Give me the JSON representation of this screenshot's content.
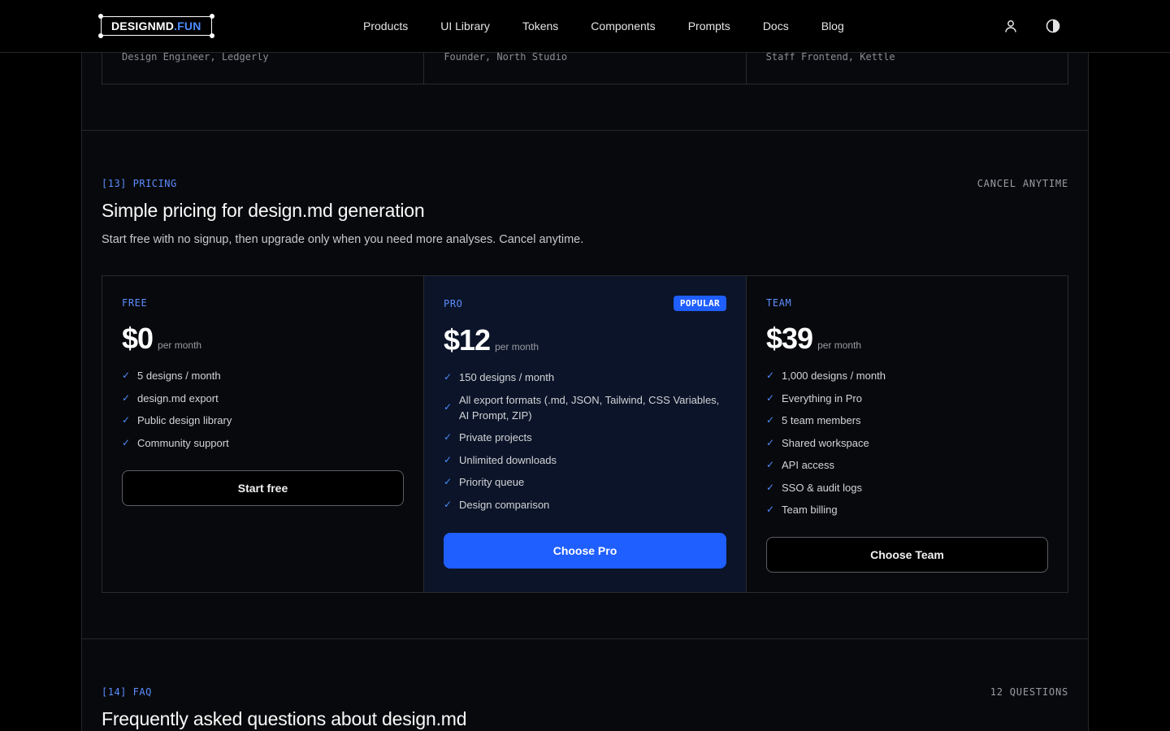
{
  "brand": {
    "name": "DESIGNMD",
    "suffix": ".FUN"
  },
  "nav": {
    "items": [
      "Products",
      "UI Library",
      "Tokens",
      "Components",
      "Prompts",
      "Docs",
      "Blog"
    ]
  },
  "header_icons": [
    "user-icon",
    "contrast-icon"
  ],
  "testimonials": [
    {
      "role": "Design Engineer, Ledgerly"
    },
    {
      "role": "Founder, North Studio"
    },
    {
      "role": "Staff Frontend, Kettle"
    }
  ],
  "pricing": {
    "label": "[13] PRICING",
    "right_label": "CANCEL ANYTIME",
    "title": "Simple pricing for design.md generation",
    "subtitle": "Start free with no signup, then upgrade only when you need more analyses. Cancel anytime.",
    "plans": [
      {
        "name": "FREE",
        "price": "$0",
        "period": "per month",
        "features": [
          "5 designs / month",
          "design.md export",
          "Public design library",
          "Community support"
        ],
        "cta": "Start free"
      },
      {
        "name": "PRO",
        "badge": "POPULAR",
        "price": "$12",
        "period": "per month",
        "features": [
          "150 designs / month",
          "All export formats (.md, JSON, Tailwind, CSS Variables, AI Prompt, ZIP)",
          "Private projects",
          "Unlimited downloads",
          "Priority queue",
          "Design comparison"
        ],
        "cta": "Choose Pro"
      },
      {
        "name": "TEAM",
        "price": "$39",
        "period": "per month",
        "features": [
          "1,000 designs / month",
          "Everything in Pro",
          "5 team members",
          "Shared workspace",
          "API access",
          "SSO & audit logs",
          "Team billing"
        ],
        "cta": "Choose Team"
      }
    ]
  },
  "faq": {
    "label": "[14] FAQ",
    "right_label": "12 QUESTIONS",
    "title": "Frequently asked questions about design.md"
  },
  "colors": {
    "accent": "#1f5eff",
    "accent_text": "#5b8dff",
    "background": "#08090c"
  }
}
